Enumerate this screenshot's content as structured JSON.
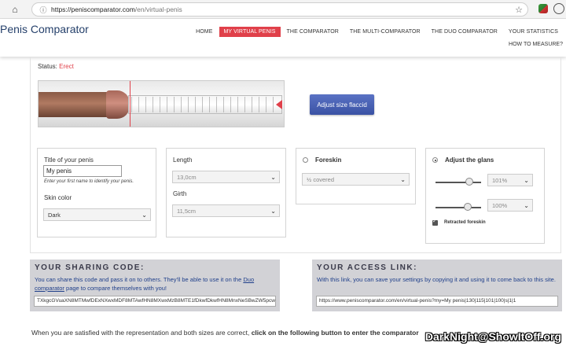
{
  "browser": {
    "url_prefix": "https://peniscomparator.com",
    "url_path": "/en/virtual-penis",
    "icons": [
      "home-icon",
      "info-icon",
      "star-icon",
      "extension-icon",
      "profile-icon"
    ]
  },
  "header": {
    "brand": "Penis Comparator",
    "nav": [
      "HOME",
      "MY VIRTUAL PENIS",
      "THE COMPARATOR",
      "THE MULTI-COMPARATOR",
      "THE DUO COMPARATOR",
      "YOUR STATISTICS"
    ],
    "active_nav": "MY VIRTUAL PENIS",
    "howto": "HOW TO MEASURE?"
  },
  "status": {
    "label": "Status:",
    "value": "Erect"
  },
  "flaccid_button": "Adjust size flaccid",
  "panel_title": {
    "label": "Title of your penis",
    "value": "My penis",
    "hint": "Enter your first name to identify your penis.",
    "skin_label": "Skin color",
    "skin_value": "Dark"
  },
  "panel_size": {
    "length_label": "Length",
    "length_value": "13,0cm",
    "girth_label": "Girth",
    "girth_value": "11,5cm"
  },
  "panel_foreskin": {
    "label": "Foreskin",
    "value": "½ covered"
  },
  "panel_glans": {
    "label": "Adjust the glans",
    "width_value": "101%",
    "length_value": "100%",
    "check_label": "Retracted foreskin"
  },
  "sharing": {
    "heading": "YOUR SHARING CODE:",
    "text_before": "You can share this code and pass it on to others. They'll be able to use it on the ",
    "link": "Duo comparator",
    "text_after": " page to compare themselves with you!",
    "code": "TXkgcGVuaXN8MTMwfDExNXwxMDF8MTAwfHN8MXwxMzB8MTE1fDkwfDkwfHN8MnxNeSBwZW5pcw=="
  },
  "access": {
    "heading": "YOUR ACCESS LINK:",
    "text": "With this link, you can save your settings by copying it and using it to come back to this site.",
    "link": "https://www.peniscomparator.com/en/virtual-penis?my=My penis|130|115|101|100|s|1|1"
  },
  "footer": {
    "text": "When you are satisfied with the representation and both sizes are correct, ",
    "bold": "click on the following button to enter the comparator"
  },
  "watermark": "DarkNight@ShowItOff.org",
  "colors": {
    "accent": "#e0404a",
    "brand": "#25406b",
    "button": "#3a52a4",
    "share_bg": "#d2d2d6"
  }
}
